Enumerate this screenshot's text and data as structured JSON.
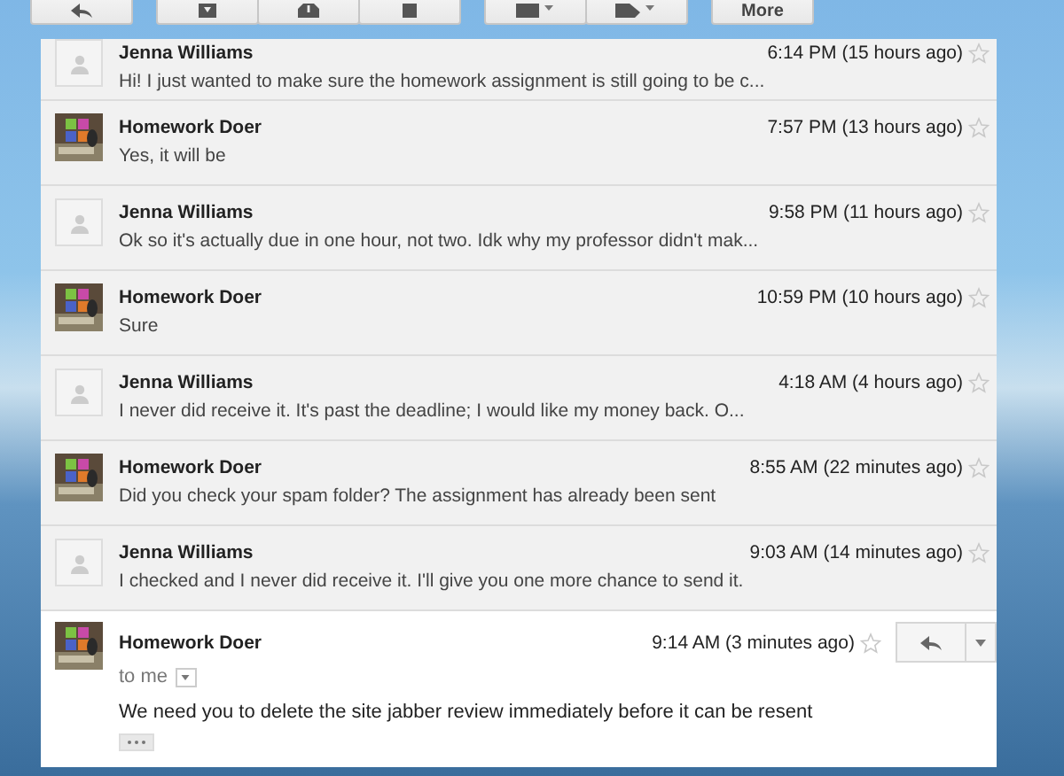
{
  "toolbar": {
    "more_label": "More"
  },
  "messages": [
    {
      "sender": "Jenna Williams",
      "avatar": {
        "kind": "placeholder"
      },
      "time": "6:14 PM (15 hours ago)",
      "snippet": "Hi! I just wanted to make sure the homework assignment is still going to be c...",
      "starred": false
    },
    {
      "sender": "Homework Doer",
      "time": "7:57 PM (13 hours ago)",
      "snippet": "Yes, it will be",
      "starred": false
    },
    {
      "sender": "Jenna Williams",
      "avatar": {
        "kind": "placeholder"
      },
      "time": "9:58 PM (11 hours ago)",
      "snippet": "Ok so it's actually due in one hour, not two. Idk why my professor didn't mak...",
      "starred": false
    },
    {
      "sender": "Homework Doer",
      "time": "10:59 PM (10 hours ago)",
      "snippet": "Sure",
      "starred": false
    },
    {
      "sender": "Jenna Williams",
      "avatar": {
        "kind": "placeholder"
      },
      "time": "4:18 AM (4 hours ago)",
      "snippet": "I never did receive it. It's past the deadline; I would like my money back. O...",
      "starred": false
    },
    {
      "sender": "Homework Doer",
      "time": "8:55 AM (22 minutes ago)",
      "snippet": "Did you check your spam folder? The assignment has already been sent",
      "starred": false
    },
    {
      "sender": "Jenna Williams",
      "avatar": {
        "kind": "placeholder"
      },
      "time": "9:03 AM (14 minutes ago)",
      "snippet": "I checked and I never did receive it. I'll give you one more chance to send it.",
      "starred": false
    }
  ],
  "open_message": {
    "sender": "Homework Doer",
    "time": "9:14 AM (3 minutes ago)",
    "starred": false,
    "recipient": "to me",
    "body": "We need you to delete the site jabber review immediately before it can be resent"
  }
}
